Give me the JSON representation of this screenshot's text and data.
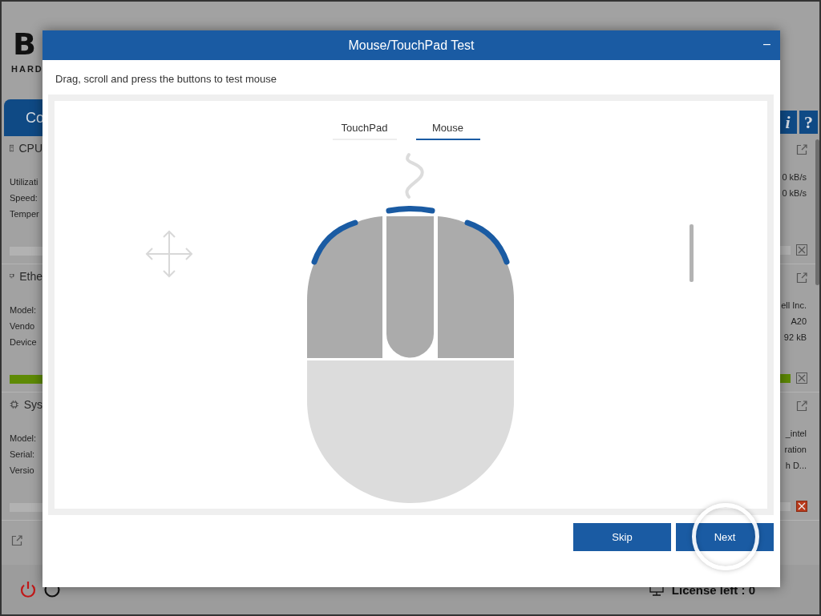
{
  "app": {
    "logo": "B",
    "logo_sub": "HARD",
    "tab": "Co",
    "icon_buttons": [
      "i",
      "?"
    ],
    "cards": [
      {
        "kind": "cpu",
        "title": "CPU",
        "labels": [
          "Utilizati",
          "Speed:",
          "Temper"
        ],
        "values": [
          "0 kB/s",
          "0 kB/s"
        ],
        "level": 0,
        "alert": false
      },
      {
        "kind": "network",
        "title": "Ethe",
        "labels": [
          "Model:",
          "Vendo",
          "Device"
        ],
        "values": [
          "ell Inc.",
          "A20",
          "92 kB"
        ],
        "level": 1,
        "alert": false
      },
      {
        "kind": "chip",
        "title": "Sys",
        "labels": [
          "Model:",
          "Serial:",
          "Versio"
        ],
        "values": [
          "_intel",
          "ration",
          "h D..."
        ],
        "level": 0,
        "alert": true
      }
    ],
    "license": "License left : 0"
  },
  "dialog": {
    "title": "Mouse/TouchPad Test",
    "minimize": "–",
    "instruction": "Drag, scroll and press the buttons to test mouse",
    "tabs": [
      {
        "label": "TouchPad",
        "selected": false
      },
      {
        "label": "Mouse",
        "selected": true
      }
    ],
    "mouse_buttons": [
      {
        "kind": "left",
        "tested": true
      },
      {
        "kind": "middle",
        "tested": true
      },
      {
        "kind": "right",
        "tested": true
      }
    ],
    "buttons": [
      {
        "label": "Skip",
        "focused": false
      },
      {
        "label": "Next",
        "focused": true
      }
    ]
  }
}
